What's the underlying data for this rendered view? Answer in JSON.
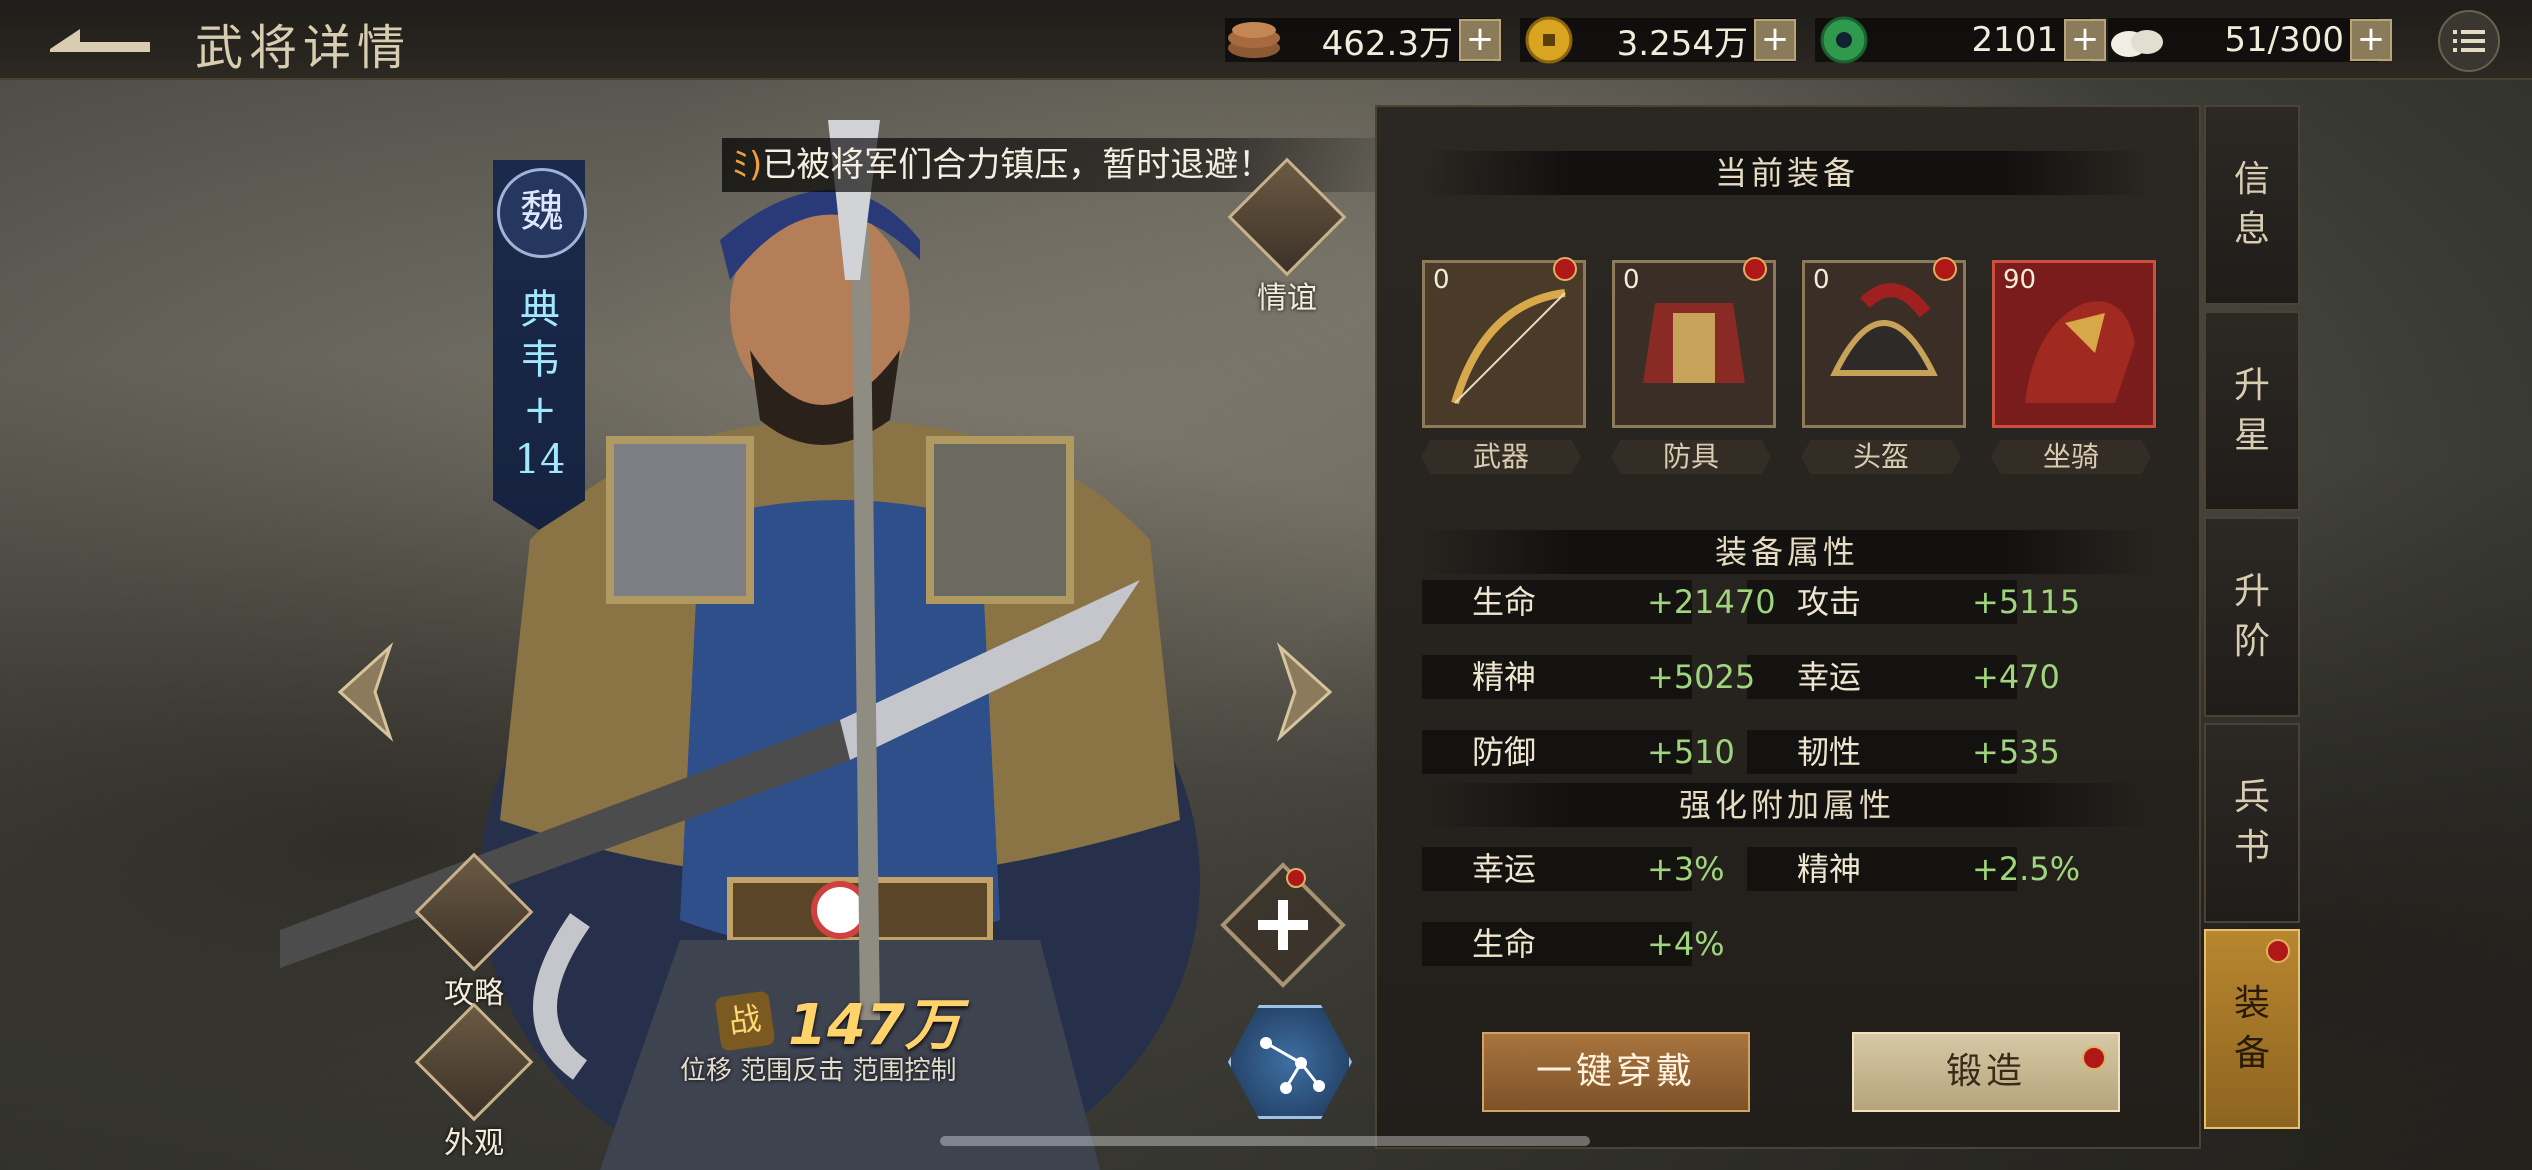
{
  "header": {
    "title": "武将详情",
    "resources": [
      {
        "icon": "copper-coins-icon",
        "value": "462.3万"
      },
      {
        "icon": "gold-coin-icon",
        "value": "3.254万"
      },
      {
        "icon": "jade-icon",
        "value": "2101"
      },
      {
        "icon": "steamed-bun-icon",
        "value": "51/300"
      }
    ],
    "plus": "+"
  },
  "hero": {
    "faction": "魏",
    "name": "典韦\n+\n14",
    "power_char": "战",
    "power": "147万",
    "skills": "位移 范围反击 范围控制"
  },
  "notice": "已被将军们合力镇压，暂时退避！",
  "left_menu": {
    "friendship": "情谊",
    "strategy": "攻略",
    "appearance": "外观"
  },
  "panel": {
    "current_equipment": "当前装备",
    "slots": [
      {
        "label": "武器",
        "level": "0",
        "icon": "bow-icon"
      },
      {
        "label": "防具",
        "level": "0",
        "icon": "armor-icon"
      },
      {
        "label": "头盔",
        "level": "0",
        "icon": "helmet-icon"
      },
      {
        "label": "坐骑",
        "level": "90",
        "icon": "horse-icon"
      }
    ],
    "equip_attrs_title": "装备属性",
    "equip_attrs": [
      [
        {
          "name": "生命",
          "value": "+21470"
        },
        {
          "name": "攻击",
          "value": "+5115"
        }
      ],
      [
        {
          "name": "精神",
          "value": "+5025"
        },
        {
          "name": "幸运",
          "value": "+470"
        }
      ],
      [
        {
          "name": "防御",
          "value": "+510"
        },
        {
          "name": "韧性",
          "value": "+535"
        }
      ]
    ],
    "bonus_attrs_title": "强化附加属性",
    "bonus_attrs": [
      [
        {
          "name": "幸运",
          "value": "+3%"
        },
        {
          "name": "精神",
          "value": "+2.5%"
        }
      ],
      [
        {
          "name": "生命",
          "value": "+4%"
        }
      ]
    ],
    "btn_wear": "一键穿戴",
    "btn_forge": "锻造"
  },
  "tabs": [
    {
      "label": "信\n息"
    },
    {
      "label": "升\n星"
    },
    {
      "label": "升\n阶"
    },
    {
      "label": "兵\n书"
    },
    {
      "label": "装\n备"
    }
  ],
  "colors": {
    "accent": "#b8862e",
    "stat_value": "#9fd67d",
    "power": "#ffd26a",
    "hero_name": "#9fe8ff"
  }
}
